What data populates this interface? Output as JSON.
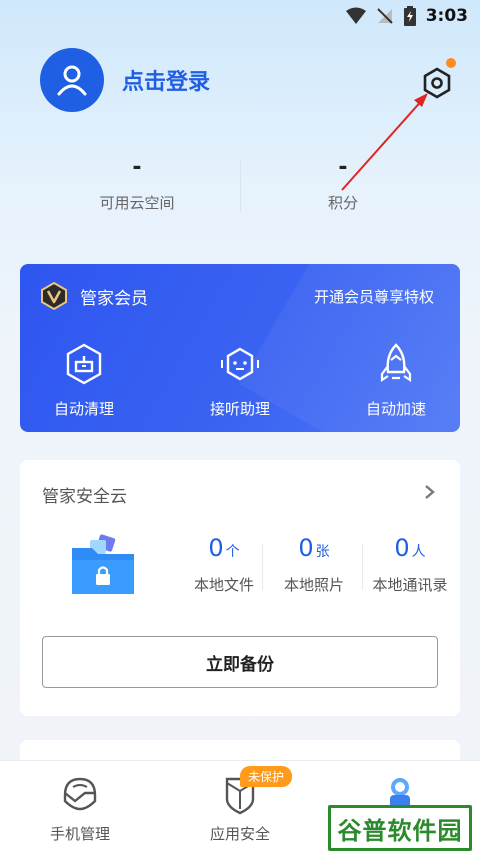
{
  "status_bar": {
    "time": "3:03"
  },
  "profile": {
    "login_label": "点击登录"
  },
  "stats": [
    {
      "value": "-",
      "label": "可用云空间"
    },
    {
      "value": "-",
      "label": "积分"
    }
  ],
  "vip": {
    "title": "管家会员",
    "promo": "开通会员尊享特权",
    "features": [
      {
        "label": "自动清理",
        "icon": "auto-clean-icon"
      },
      {
        "label": "接听助理",
        "icon": "call-assistant-icon"
      },
      {
        "label": "自动加速",
        "icon": "rocket-icon"
      }
    ]
  },
  "cloud": {
    "title": "管家安全云",
    "stats": [
      {
        "value": "0",
        "unit": "个",
        "label": "本地文件"
      },
      {
        "value": "0",
        "unit": "张",
        "label": "本地照片"
      },
      {
        "value": "0",
        "unit": "人",
        "label": "本地通讯录"
      }
    ],
    "backup_label": "立即备份"
  },
  "nav": {
    "items": [
      {
        "label": "手机管理",
        "icon": "helmet-icon"
      },
      {
        "label": "应用安全",
        "icon": "shield-icon"
      }
    ],
    "badge": "未保护"
  },
  "watermark": "谷普软件园",
  "colors": {
    "accent": "#1f5fe3",
    "vip_card": "#3a63f2",
    "badge": "#ff9a1a"
  }
}
